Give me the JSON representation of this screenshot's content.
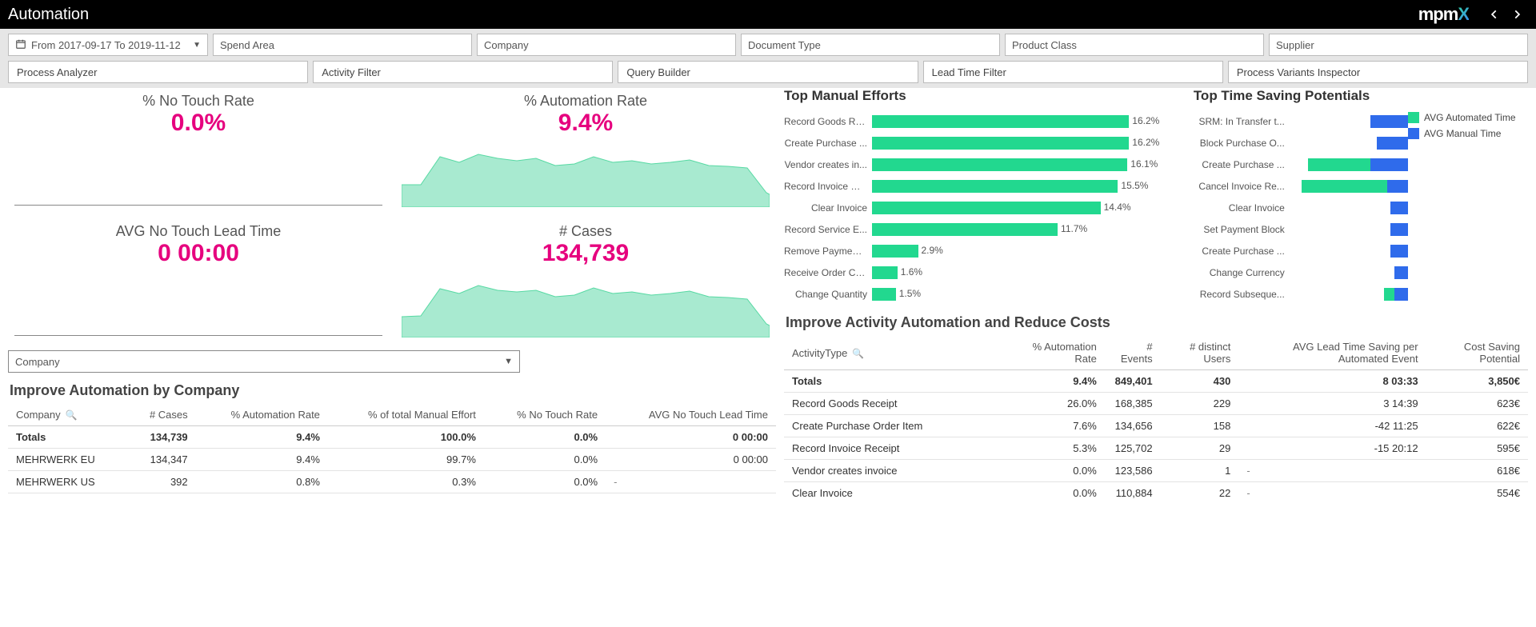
{
  "topbar": {
    "title": "Automation",
    "brand_main": "mpm",
    "brand_x": "X"
  },
  "filters": {
    "daterange": "From 2017-09-17 To 2019-11-12",
    "f1": "Spend Area",
    "f2": "Company",
    "f3": "Document Type",
    "f4": "Product Class",
    "f5": "Supplier"
  },
  "tabs": {
    "t1": "Process Analyzer",
    "t2": "Activity Filter",
    "t3": "Query Builder",
    "t4": "Lead Time Filter",
    "t5": "Process Variants Inspector"
  },
  "kpi": {
    "no_touch_rate": {
      "label": "% No Touch Rate",
      "value": "0.0%"
    },
    "automation_rate": {
      "label": "% Automation Rate",
      "value": "9.4%"
    },
    "no_touch_lead": {
      "label": "AVG No Touch Lead Time",
      "value": "0 00:00"
    },
    "cases": {
      "label": "# Cases",
      "value": "134,739"
    }
  },
  "company_selector": "Company",
  "improve_company": {
    "title": "Improve Automation by Company",
    "headers": {
      "company": "Company",
      "cases": "# Cases",
      "auto": "% Automation Rate",
      "manual": "% of total Manual Effort",
      "notouch": "% No Touch Rate",
      "lead": "AVG No Touch Lead Time"
    },
    "totals": {
      "company": "Totals",
      "cases": "134,739",
      "auto": "9.4%",
      "manual": "100.0%",
      "notouch": "0.0%",
      "lead": "0 00:00"
    },
    "rows": [
      {
        "company": "MEHRWERK EU",
        "cases": "134,347",
        "auto": "9.4%",
        "manual": "99.7%",
        "notouch": "0.0%",
        "lead": "0 00:00"
      },
      {
        "company": "MEHRWERK US",
        "cases": "392",
        "auto": "0.8%",
        "manual": "0.3%",
        "notouch": "0.0%",
        "lead": "-"
      }
    ]
  },
  "top_manual": {
    "title": "Top Manual Efforts",
    "items": [
      {
        "label": "Record Goods Re...",
        "pct": 16.2
      },
      {
        "label": "Create Purchase ...",
        "pct": 16.2
      },
      {
        "label": "Vendor creates in...",
        "pct": 16.1
      },
      {
        "label": "Record Invoice Re...",
        "pct": 15.5
      },
      {
        "label": "Clear Invoice",
        "pct": 14.4
      },
      {
        "label": "Record Service E...",
        "pct": 11.7
      },
      {
        "label": "Remove Payment...",
        "pct": 2.9
      },
      {
        "label": "Receive Order Co...",
        "pct": 1.6
      },
      {
        "label": "Change Quantity",
        "pct": 1.5
      }
    ]
  },
  "top_saving": {
    "title": "Top Time Saving Potentials",
    "legend": {
      "auto": "AVG Automated Time",
      "manual": "AVG Manual Time"
    },
    "items": [
      {
        "label": "SRM: In Transfer t...",
        "auto": 0,
        "manual": 22
      },
      {
        "label": "Block Purchase O...",
        "auto": 0,
        "manual": 18
      },
      {
        "label": "Create Purchase ...",
        "auto": 36,
        "manual": 22
      },
      {
        "label": "Cancel Invoice Re...",
        "auto": 50,
        "manual": 12
      },
      {
        "label": "Clear Invoice",
        "auto": 0,
        "manual": 10
      },
      {
        "label": "Set Payment Block",
        "auto": 0,
        "manual": 10
      },
      {
        "label": "Create Purchase ...",
        "auto": 0,
        "manual": 10
      },
      {
        "label": "Change Currency",
        "auto": 0,
        "manual": 8
      },
      {
        "label": "Record Subseque...",
        "auto": 6,
        "manual": 8
      }
    ]
  },
  "improve_activity": {
    "title": "Improve Activity Automation and Reduce Costs",
    "headers": {
      "act": "ActivityType",
      "auto": "% Automation Rate",
      "events": "# Events",
      "users": "# distinct Users",
      "lead": "AVG Lead Time Saving per Automated Event",
      "cost": "Cost Saving Potential"
    },
    "totals": {
      "act": "Totals",
      "auto": "9.4%",
      "events": "849,401",
      "users": "430",
      "lead": "8 03:33",
      "cost": "3,850€"
    },
    "rows": [
      {
        "act": "Record Goods Receipt",
        "auto": "26.0%",
        "events": "168,385",
        "users": "229",
        "lead": "3 14:39",
        "cost": "623€"
      },
      {
        "act": "Create Purchase Order Item",
        "auto": "7.6%",
        "events": "134,656",
        "users": "158",
        "lead": "-42 11:25",
        "cost": "622€"
      },
      {
        "act": "Record Invoice Receipt",
        "auto": "5.3%",
        "events": "125,702",
        "users": "29",
        "lead": "-15 20:12",
        "cost": "595€"
      },
      {
        "act": "Vendor creates invoice",
        "auto": "0.0%",
        "events": "123,586",
        "users": "1",
        "lead": "-",
        "cost": "618€"
      },
      {
        "act": "Clear Invoice",
        "auto": "0.0%",
        "events": "110,884",
        "users": "22",
        "lead": "-",
        "cost": "554€"
      }
    ]
  },
  "chart_data": [
    {
      "type": "bar",
      "title": "Top Manual Efforts",
      "orientation": "horizontal",
      "categories": [
        "Record Goods Re...",
        "Create Purchase ...",
        "Vendor creates in...",
        "Record Invoice Re...",
        "Clear Invoice",
        "Record Service E...",
        "Remove Payment...",
        "Receive Order Co...",
        "Change Quantity"
      ],
      "values": [
        16.2,
        16.2,
        16.1,
        15.5,
        14.4,
        11.7,
        2.9,
        1.6,
        1.5
      ],
      "xlabel": "%",
      "ylabel": ""
    },
    {
      "type": "bar",
      "title": "Top Time Saving Potentials",
      "orientation": "horizontal",
      "stacked": true,
      "categories": [
        "SRM: In Transfer t...",
        "Block Purchase O...",
        "Create Purchase ...",
        "Cancel Invoice Re...",
        "Clear Invoice",
        "Set Payment Block",
        "Create Purchase ...",
        "Change Currency",
        "Record Subseque..."
      ],
      "series": [
        {
          "name": "AVG Automated Time",
          "values": [
            0,
            0,
            36,
            50,
            0,
            0,
            0,
            0,
            6
          ]
        },
        {
          "name": "AVG Manual Time",
          "values": [
            22,
            18,
            22,
            12,
            10,
            10,
            10,
            8,
            8
          ]
        }
      ],
      "note": "values are relative widths (no numeric axis shown)"
    },
    {
      "type": "area",
      "title": "% Automation Rate sparkline",
      "x": [
        0,
        1,
        2,
        3,
        4,
        5,
        6,
        7,
        8,
        9,
        10,
        11,
        12,
        13,
        14,
        15,
        16,
        17,
        18,
        19
      ],
      "values": [
        60,
        60,
        95,
        85,
        98,
        92,
        88,
        92,
        80,
        82,
        95,
        85,
        88,
        82,
        85,
        90,
        80,
        78,
        76,
        30
      ],
      "note": "approximate trend; no axes rendered"
    },
    {
      "type": "area",
      "title": "# Cases sparkline",
      "x": [
        0,
        1,
        2,
        3,
        4,
        5,
        6,
        7,
        8,
        9,
        10,
        11,
        12,
        13,
        14,
        15,
        16,
        17,
        18,
        19
      ],
      "values": [
        55,
        58,
        92,
        83,
        96,
        90,
        86,
        90,
        78,
        80,
        93,
        84,
        86,
        80,
        84,
        88,
        78,
        77,
        74,
        28
      ],
      "note": "approximate trend; no axes rendered"
    }
  ]
}
